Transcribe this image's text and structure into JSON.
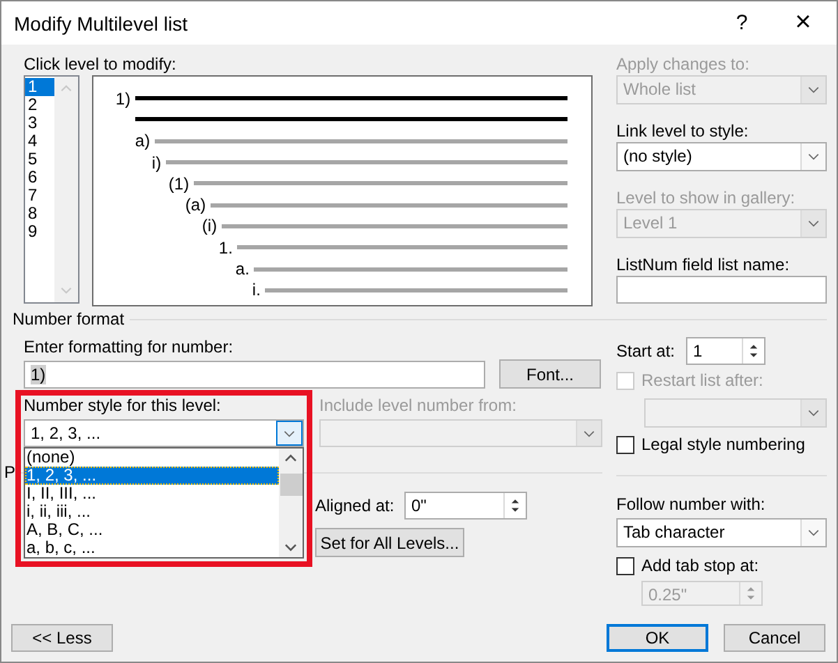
{
  "window": {
    "title": "Modify Multilevel list",
    "help": "?",
    "close": "×"
  },
  "levels": {
    "label": "Click level to modify:",
    "items": [
      {
        "label": "1",
        "selected": true
      },
      {
        "label": "2",
        "selected": false
      },
      {
        "label": "3",
        "selected": false
      },
      {
        "label": "4",
        "selected": false
      },
      {
        "label": "5",
        "selected": false
      },
      {
        "label": "6",
        "selected": false
      },
      {
        "label": "7",
        "selected": false
      },
      {
        "label": "8",
        "selected": false
      },
      {
        "label": "9",
        "selected": false
      }
    ]
  },
  "preview": {
    "rows": [
      "1)",
      "a)",
      "i)",
      "(1)",
      "(a)",
      "(i)",
      "1.",
      "a.",
      "i."
    ]
  },
  "apply_changes": {
    "label": "Apply changes to:",
    "value": "Whole list",
    "disabled": true
  },
  "link_style": {
    "label": "Link level to style:",
    "value": "(no style)",
    "disabled": false
  },
  "gallery_level": {
    "label": "Level to show in gallery:",
    "value": "Level 1",
    "disabled": true
  },
  "listnum": {
    "label": "ListNum field list name:"
  },
  "number_format": {
    "title": "Number format",
    "format_label": "Enter formatting for number:",
    "format_value": "1)",
    "font_button": "Font...",
    "style_label": "Number style for this level:",
    "style_value": "1, 2, 3, ...",
    "style_options": [
      {
        "label": "(none)",
        "selected": false
      },
      {
        "label": "1, 2, 3, ...",
        "selected": true
      },
      {
        "label": "I, II, III, ...",
        "selected": false
      },
      {
        "label": "i, ii, iii, ...",
        "selected": false
      },
      {
        "label": "A, B, C, ...",
        "selected": false
      },
      {
        "label": "a, b, c, ...",
        "selected": false
      }
    ],
    "include_label": "Include level number from:",
    "start_label": "Start at:",
    "start_value": "1",
    "restart": {
      "label": "Restart list after:",
      "checked": false,
      "disabled": true
    },
    "legal": {
      "label": "Legal style numbering",
      "checked": false
    }
  },
  "position": {
    "title": "P",
    "aligned_label": "Aligned at:",
    "aligned_value": "0\"",
    "set_all_button": "Set for All Levels...",
    "follow_label": "Follow number with:",
    "follow_value": "Tab character",
    "tab_stop": {
      "label": "Add tab stop at:",
      "checked": false
    },
    "tab_stop_value": "0.25\"",
    "tab_stop_disabled": true
  },
  "buttons": [
    {
      "label": "<< Less",
      "default": false
    },
    {
      "label": "OK",
      "default": true
    },
    {
      "label": "Cancel",
      "default": false
    }
  ]
}
